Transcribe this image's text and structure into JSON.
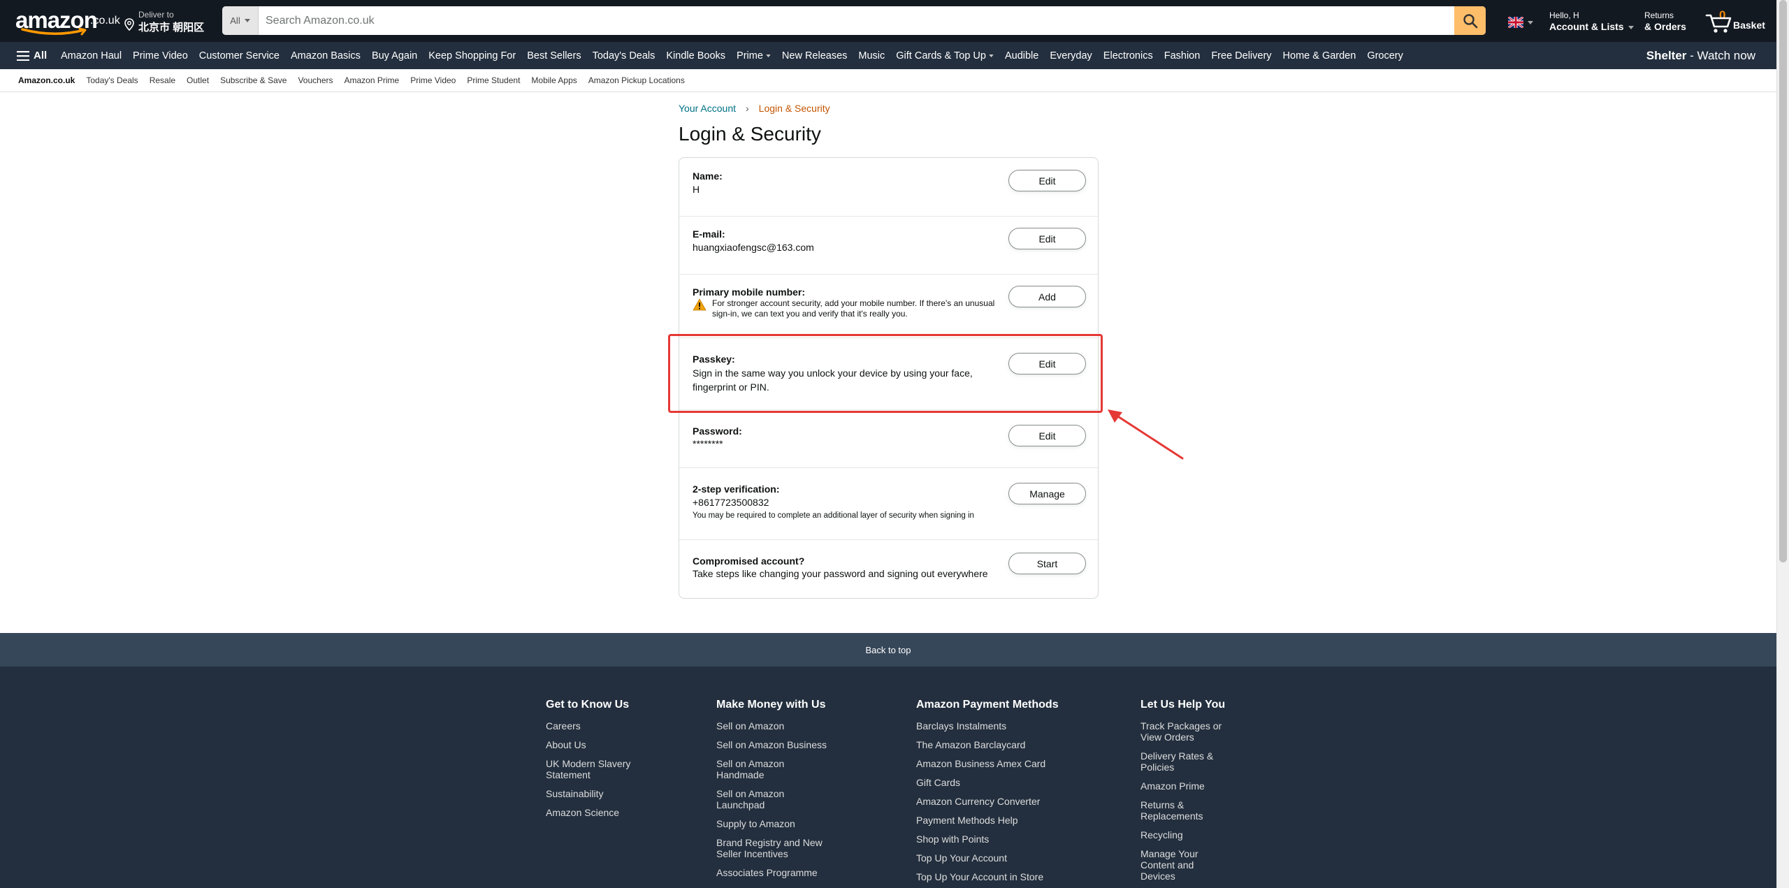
{
  "header": {
    "logo_text": "amazon",
    "logo_tld": ".co.uk",
    "deliver_line1": "Deliver to",
    "deliver_line2": "北京市 朝阳区",
    "search_category": "All",
    "search_placeholder": "Search Amazon.co.uk",
    "account_line1": "Hello, H",
    "account_line2": "Account & Lists",
    "returns_line1": "Returns",
    "returns_line2": "& Orders",
    "basket_count": "0",
    "basket_label": "Basket"
  },
  "nav": {
    "all_label": "All",
    "links": [
      "Amazon Haul",
      "Prime Video",
      "Customer Service",
      "Amazon Basics",
      "Buy Again",
      "Keep Shopping For",
      "Best Sellers",
      "Today's Deals",
      "Kindle Books",
      "Prime",
      "New Releases",
      "Music",
      "Gift Cards & Top Up",
      "Audible",
      "Everyday",
      "Electronics",
      "Fashion",
      "Free Delivery",
      "Home & Garden",
      "Grocery"
    ],
    "promo_bold": "Shelter",
    "promo_rest": " - Watch now"
  },
  "subnav": {
    "links": [
      "Amazon.co.uk",
      "Today's Deals",
      "Resale",
      "Outlet",
      "Subscribe & Save",
      "Vouchers",
      "Amazon Prime",
      "Prime Video",
      "Prime Student",
      "Mobile Apps",
      "Amazon Pickup Locations"
    ]
  },
  "breadcrumb": {
    "parent": "Your Account",
    "separator": "›",
    "current": "Login & Security"
  },
  "page_title": "Login & Security",
  "rows": {
    "name": {
      "label": "Name:",
      "value": "H",
      "button": "Edit"
    },
    "email": {
      "label": "E-mail:",
      "value": "huangxiaofengsc@163.com",
      "button": "Edit"
    },
    "mobile": {
      "label": "Primary mobile number:",
      "warning": "For stronger account security, add your mobile number. If there's an unusual sign-in, we can text you and verify that it's really you.",
      "button": "Add"
    },
    "passkey": {
      "label": "Passkey:",
      "value": "Sign in the same way you unlock your device by using your face, fingerprint or PIN.",
      "button": "Edit"
    },
    "password": {
      "label": "Password:",
      "value": "********",
      "button": "Edit"
    },
    "twostep": {
      "label": "2-step verification:",
      "value": "+8617723500832",
      "note": "You may be required to complete an additional layer of security when signing in",
      "button": "Manage"
    },
    "compromised": {
      "label": "Compromised account?",
      "value": "Take steps like changing your password and signing out everywhere",
      "button": "Start"
    }
  },
  "footer": {
    "back_to_top": "Back to top",
    "columns": [
      {
        "title": "Get to Know Us",
        "links": [
          "Careers",
          "About Us",
          "UK Modern Slavery Statement",
          "Sustainability",
          "Amazon Science"
        ]
      },
      {
        "title": "Make Money with Us",
        "links": [
          "Sell on Amazon",
          "Sell on Amazon Business",
          "Sell on Amazon Handmade",
          "Sell on Amazon Launchpad",
          "Supply to Amazon",
          "Brand Registry and New Seller Incentives",
          "Associates Programme"
        ]
      },
      {
        "title": "Amazon Payment Methods",
        "links": [
          "Barclays Instalments",
          "The Amazon Barclaycard",
          "Amazon Business Amex Card",
          "Gift Cards",
          "Amazon Currency Converter",
          "Payment Methods Help",
          "Shop with Points",
          "Top Up Your Account",
          "Top Up Your Account in Store"
        ]
      },
      {
        "title": "Let Us Help You",
        "links": [
          "Track Packages or View Orders",
          "Delivery Rates & Policies",
          "Amazon Prime",
          "Returns & Replacements",
          "Recycling",
          "Manage Your Content and Devices"
        ]
      }
    ]
  },
  "colors": {
    "nav_dark": "#131921",
    "nav_secondary": "#232f3e",
    "search_button": "#febd69",
    "link": "#007185",
    "breadcrumb_current": "#c45500",
    "annotation_red": "#e53935"
  }
}
